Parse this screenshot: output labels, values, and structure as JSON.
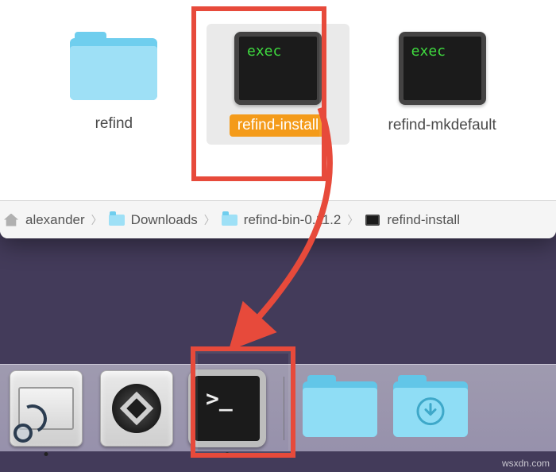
{
  "finder": {
    "items": [
      {
        "name": "refind",
        "kind": "folder",
        "selected": false
      },
      {
        "name": "refind-install",
        "kind": "exec",
        "selected": true
      },
      {
        "name": "refind-mkdefault",
        "kind": "exec",
        "selected": false
      }
    ],
    "exec_badge_text": "exec"
  },
  "pathbar": {
    "crumbs": [
      {
        "label": "alexander",
        "icon": "home"
      },
      {
        "label": "Downloads",
        "icon": "folder"
      },
      {
        "label": "refind-bin-0.11.2",
        "icon": "folder"
      },
      {
        "label": "refind-install",
        "icon": "exec"
      }
    ]
  },
  "dock": {
    "items_left": [
      {
        "name": "disk-utility",
        "running": true
      },
      {
        "name": "boot-camp-assistant",
        "running": false
      },
      {
        "name": "terminal",
        "running": true
      }
    ],
    "items_right": [
      {
        "name": "folder-generic"
      },
      {
        "name": "downloads-folder"
      }
    ],
    "terminal_prompt": ">_"
  },
  "annotation": {
    "highlight_color": "#e74a3b",
    "arrow_color": "#e74a3b"
  },
  "watermark": "wsxdn.com"
}
